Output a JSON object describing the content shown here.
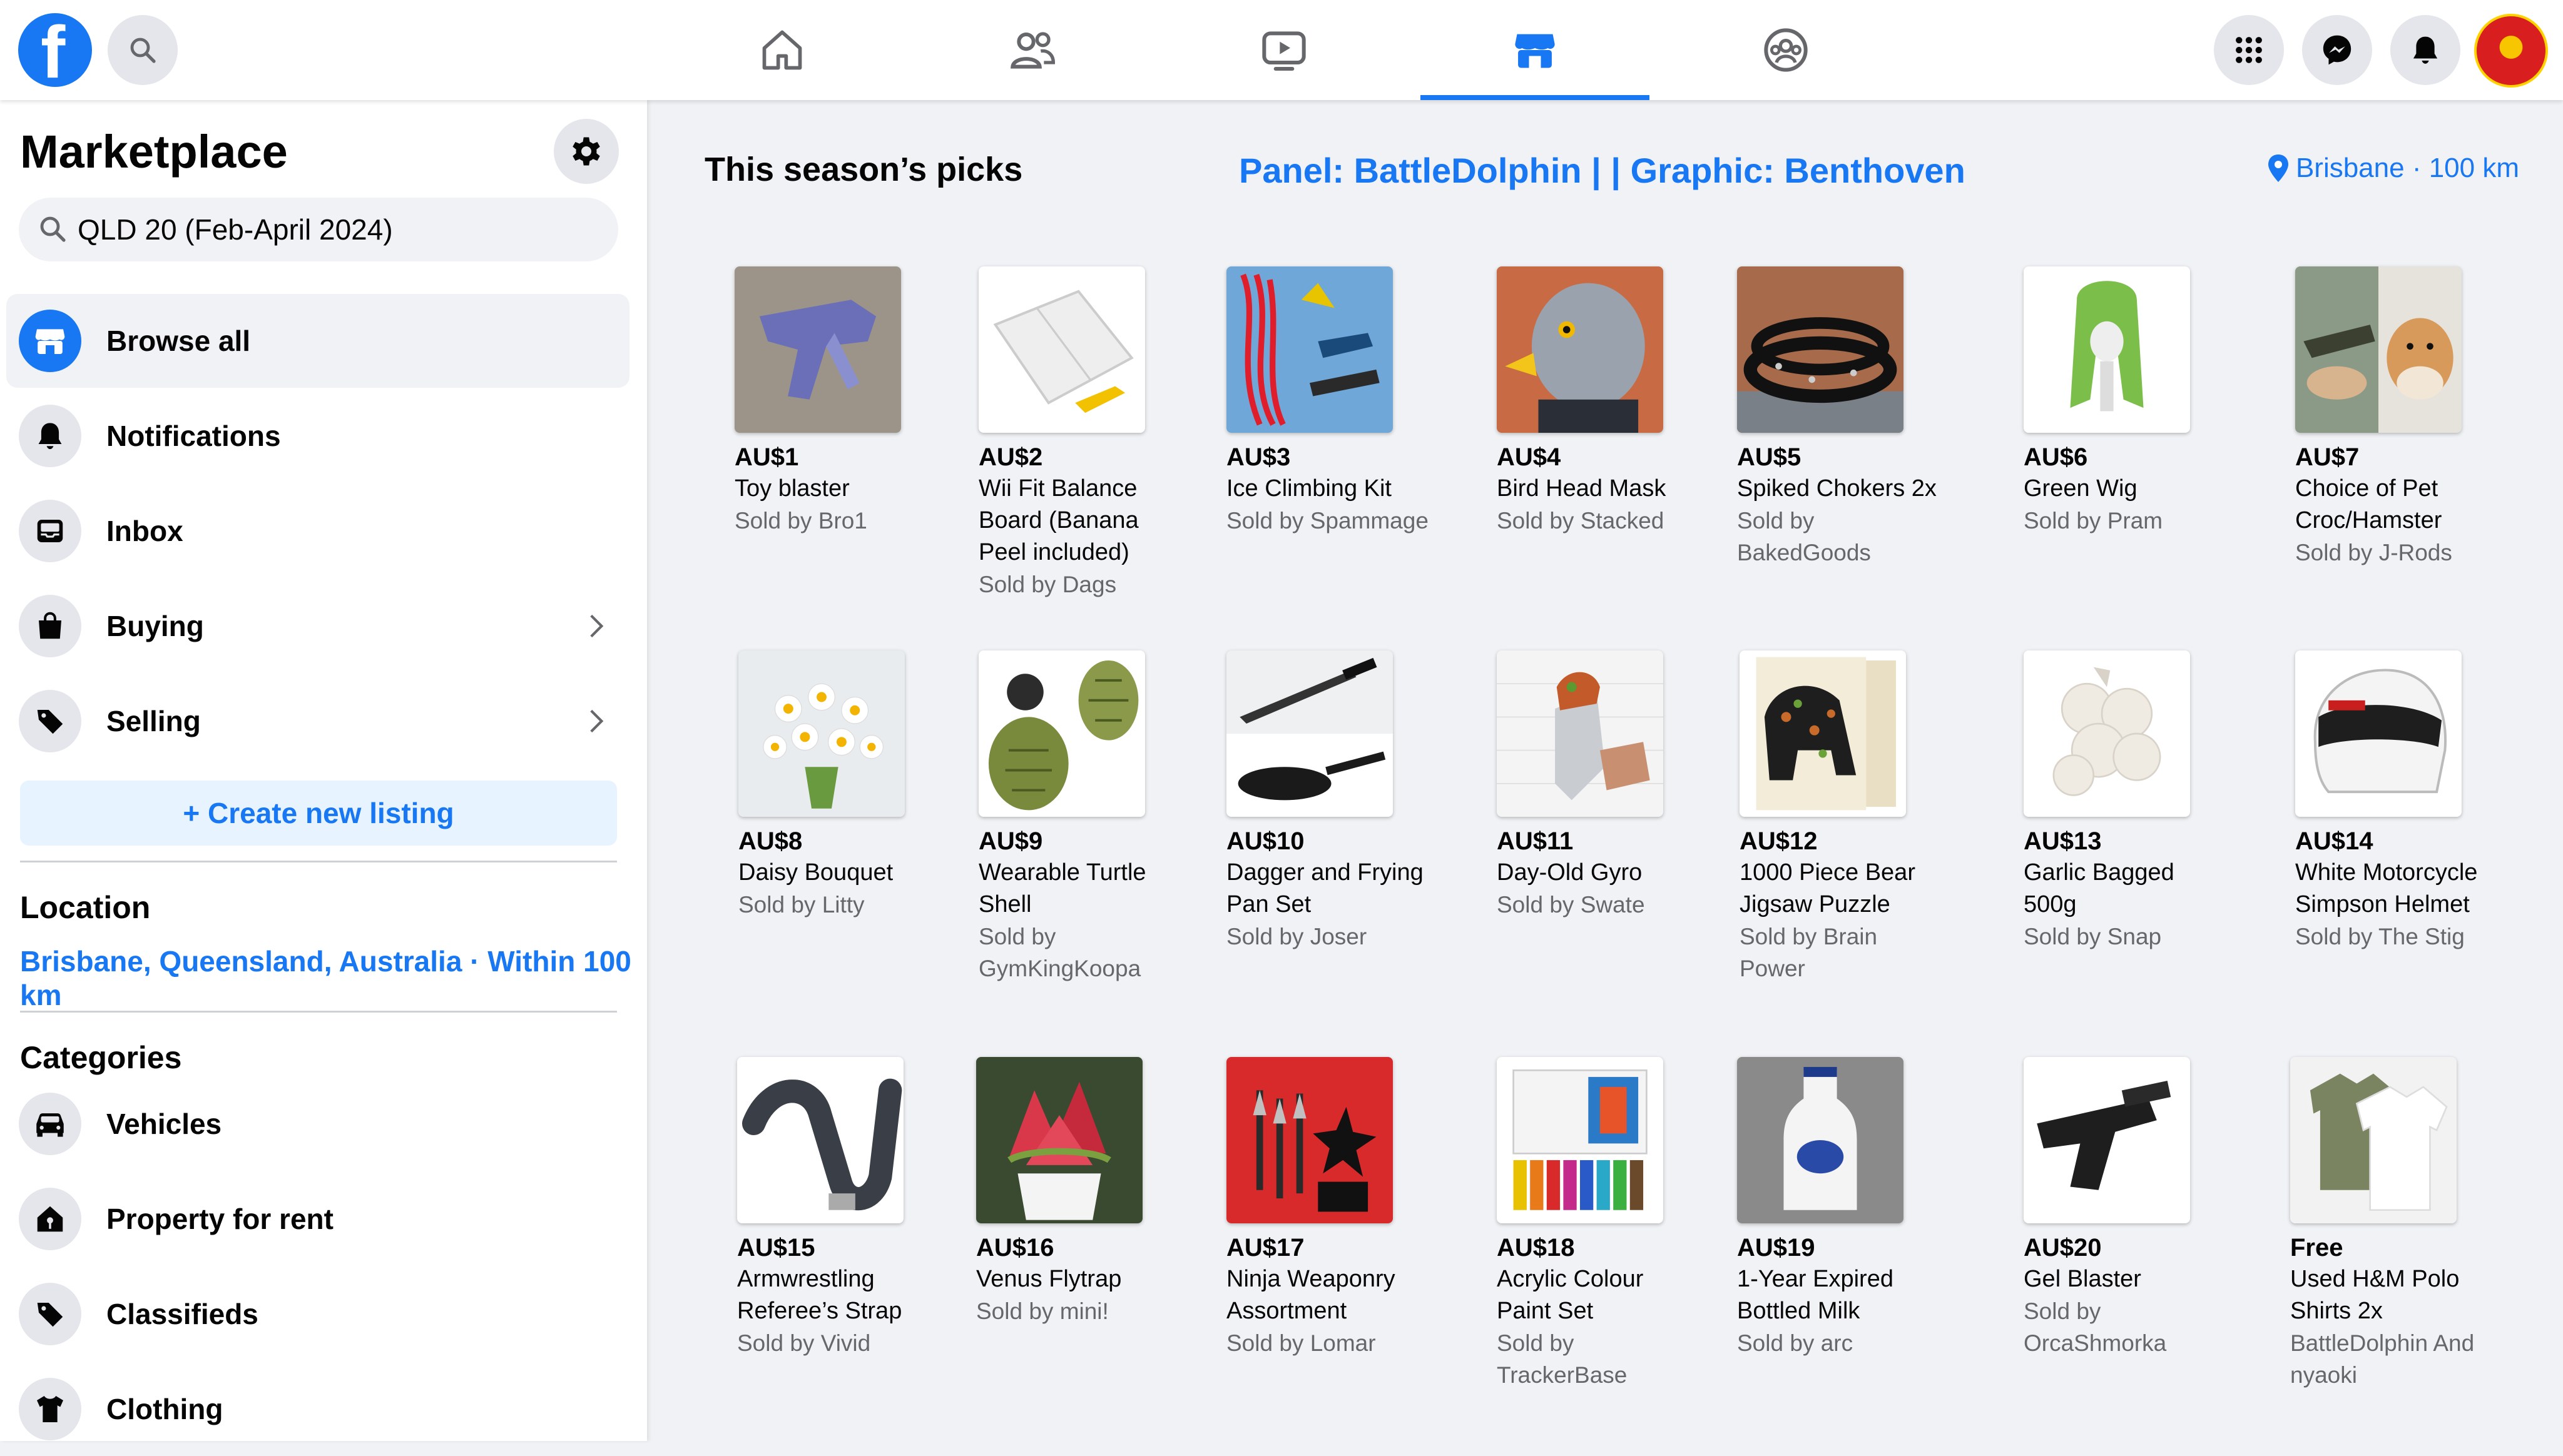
{
  "header": {
    "icons": [
      "facebook-logo",
      "search-icon",
      "home-icon",
      "friends-icon",
      "watch-icon",
      "marketplace-icon",
      "groups-icon",
      "menu-grid-icon",
      "messenger-icon",
      "bell-icon",
      "avatar"
    ]
  },
  "sidebar": {
    "title": "Marketplace",
    "search_value": "QLD 20 (Feb-April 2024)",
    "items": [
      {
        "label": "Browse all"
      },
      {
        "label": "Notifications"
      },
      {
        "label": "Inbox"
      },
      {
        "label": "Buying"
      },
      {
        "label": "Selling"
      }
    ],
    "create_label": "+ Create new listing",
    "location_heading": "Location",
    "location_value": "Brisbane, Queensland, Australia · Within 100 km",
    "categories_heading": "Categories",
    "categories": [
      {
        "label": "Vehicles"
      },
      {
        "label": "Property for rent"
      },
      {
        "label": "Classifieds"
      },
      {
        "label": "Clothing"
      }
    ]
  },
  "main": {
    "heading": "This season’s picks",
    "credit": "Panel: BattleDolphin | | Graphic: Benthoven",
    "location_chip": "Brisbane · 100 km",
    "items": [
      {
        "price": "AU$1",
        "title": "Toy blaster",
        "seller": "Sold by Bro1"
      },
      {
        "price": "AU$2",
        "title": "Wii Fit Balance Board (Banana Peel included)",
        "seller": "Sold by Dags"
      },
      {
        "price": "AU$3",
        "title": "Ice Climbing Kit",
        "seller": "Sold by Spammage"
      },
      {
        "price": "AU$4",
        "title": "Bird Head Mask",
        "seller": "Sold by Stacked"
      },
      {
        "price": "AU$5",
        "title": "Spiked Chokers 2x",
        "seller": "Sold by BakedGoods"
      },
      {
        "price": "AU$6",
        "title": "Green Wig",
        "seller": "Sold by Pram"
      },
      {
        "price": "AU$7",
        "title": "Choice of Pet Croc/Hamster",
        "seller": "Sold by J-Rods"
      },
      {
        "price": "AU$8",
        "title": "Daisy Bouquet",
        "seller": "Sold by Litty"
      },
      {
        "price": "AU$9",
        "title": "Wearable Turtle Shell",
        "seller": "Sold by GymKingKoopa"
      },
      {
        "price": "AU$10",
        "title": "Dagger and Frying Pan Set",
        "seller": "Sold by Joser"
      },
      {
        "price": "AU$11",
        "title": "Day-Old Gyro",
        "seller": "Sold by Swate"
      },
      {
        "price": "AU$12",
        "title": "1000 Piece Bear Jigsaw Puzzle",
        "seller": "Sold by Brain Power"
      },
      {
        "price": "AU$13",
        "title": "Garlic Bagged 500g",
        "seller": "Sold by Snap"
      },
      {
        "price": "AU$14",
        "title": "White Motorcycle Simpson Helmet",
        "seller": "Sold by The Stig"
      },
      {
        "price": "AU$15",
        "title": "Armwrestling Referee’s Strap",
        "seller": "Sold by Vivid"
      },
      {
        "price": "AU$16",
        "title": "Venus Flytrap",
        "seller": "Sold by mini!"
      },
      {
        "price": "AU$17",
        "title": "Ninja Weaponry Assortment",
        "seller": "Sold by Lomar"
      },
      {
        "price": "AU$18",
        "title": "Acrylic Colour Paint Set",
        "seller": "Sold by TrackerBase"
      },
      {
        "price": "AU$19",
        "title": "1-Year Expired Bottled Milk",
        "seller": "Sold by arc"
      },
      {
        "price": "AU$20",
        "title": "Gel Blaster",
        "seller": "Sold by OrcaShmorka"
      },
      {
        "price": "Free",
        "title": "Used H&M Polo Shirts 2x",
        "seller": "BattleDolphin And nyaoki"
      }
    ]
  },
  "colors": {
    "accent": "#1877f2",
    "background": "#f0f2f5",
    "secondary_text": "#65676b"
  }
}
